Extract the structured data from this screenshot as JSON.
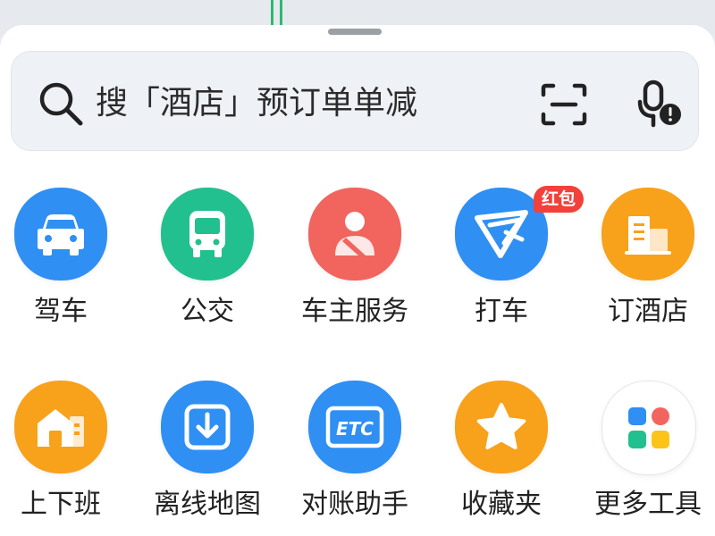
{
  "search": {
    "placeholder": "搜「酒店」预订单单减"
  },
  "tools": [
    {
      "id": "drive",
      "label": "驾车",
      "icon": "car-icon",
      "color": "#2f8ff3"
    },
    {
      "id": "bus",
      "label": "公交",
      "icon": "bus-icon",
      "color": "#22c08e"
    },
    {
      "id": "owner",
      "label": "车主服务",
      "icon": "person-icon",
      "color": "#f2645e"
    },
    {
      "id": "taxi",
      "label": "打车",
      "icon": "taxi-icon",
      "color": "#2f8ff3",
      "badge": "红包"
    },
    {
      "id": "hotel",
      "label": "订酒店",
      "icon": "building-icon",
      "color": "#f8a11b"
    },
    {
      "id": "commute",
      "label": "上下班",
      "icon": "home-icon",
      "color": "#f8a11b"
    },
    {
      "id": "offline",
      "label": "离线地图",
      "icon": "download-icon",
      "color": "#2f8ff3"
    },
    {
      "id": "etc",
      "label": "对账助手",
      "icon": "etc-icon",
      "icon_text": "ETC",
      "color": "#2f8ff3"
    },
    {
      "id": "favorites",
      "label": "收藏夹",
      "icon": "star-icon",
      "color": "#f8a11b"
    },
    {
      "id": "more",
      "label": "更多工具",
      "icon": "grid-icon",
      "color": "#ffffff"
    }
  ],
  "colors": {
    "accent_blue": "#2f8ff3",
    "accent_green": "#22c08e",
    "accent_red": "#f2645e",
    "accent_orange": "#f8a11b",
    "badge_red": "#f2413a"
  }
}
